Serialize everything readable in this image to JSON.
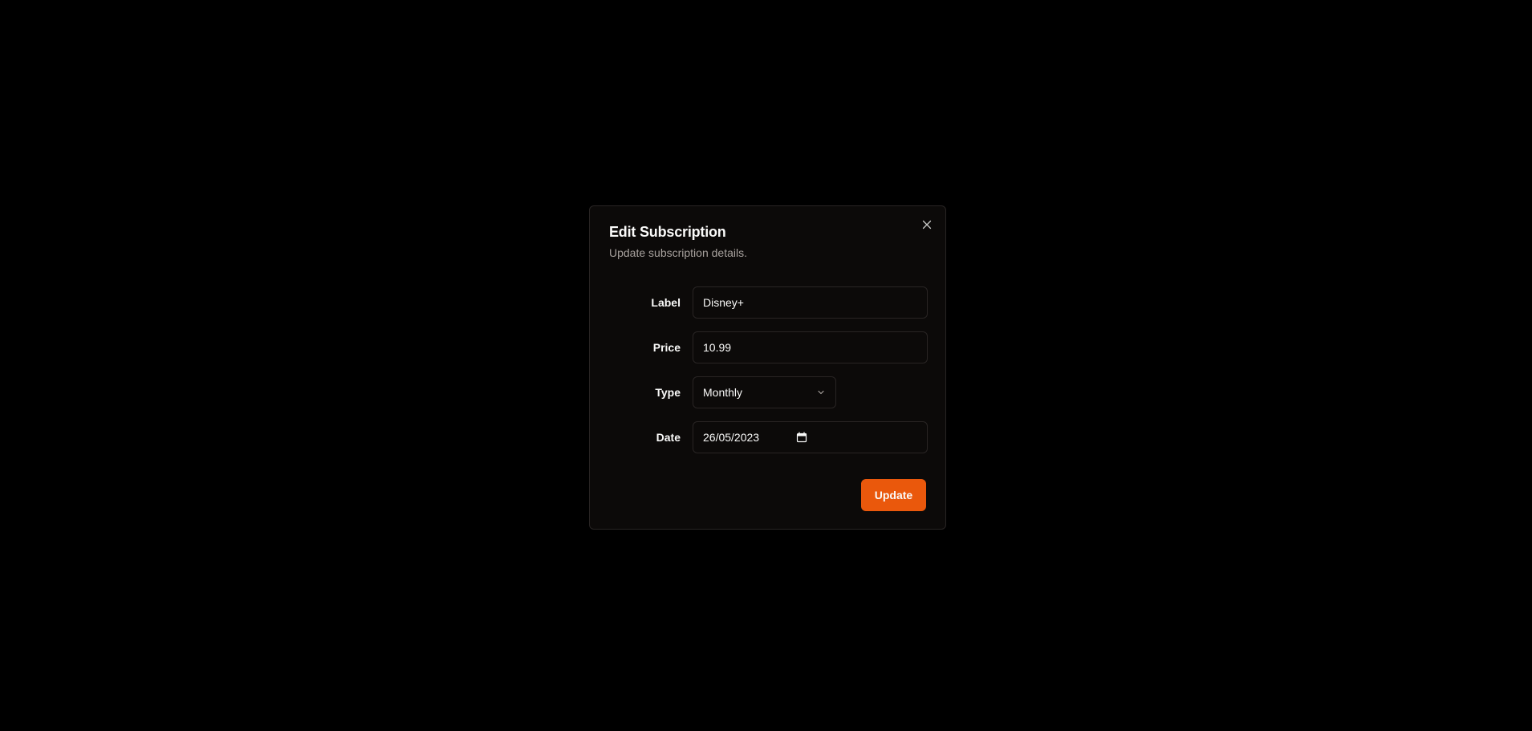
{
  "dialog": {
    "title": "Edit Subscription",
    "subtitle": "Update subscription details.",
    "close_icon": "close-icon"
  },
  "form": {
    "label": {
      "label": "Label",
      "value": "Disney+"
    },
    "price": {
      "label": "Price",
      "value": "10.99"
    },
    "type": {
      "label": "Type",
      "value": "Monthly",
      "icon": "chevron-down-icon"
    },
    "date": {
      "label": "Date",
      "value": "26/05/2023",
      "icon": "calendar-icon"
    }
  },
  "actions": {
    "update_label": "Update"
  },
  "colors": {
    "background": "#000000",
    "dialog_bg": "#0c0a09",
    "border": "#292524",
    "accent": "#ea580c",
    "text": "#fafaf9",
    "muted_text": "#a8a29e"
  }
}
